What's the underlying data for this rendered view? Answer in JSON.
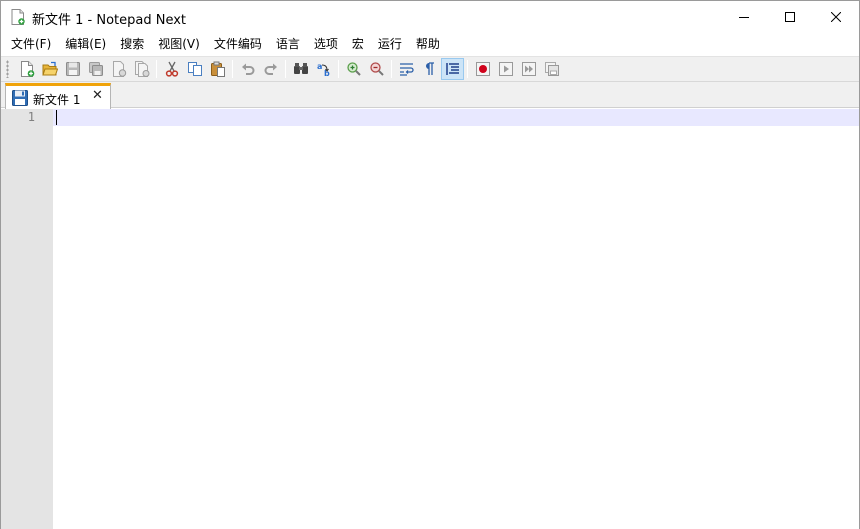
{
  "window": {
    "title": "新文件 1 - Notepad Next"
  },
  "menu": {
    "items": [
      "文件(F)",
      "编辑(E)",
      "搜索",
      "视图(V)",
      "文件编码",
      "语言",
      "选项",
      "宏",
      "运行",
      "帮助"
    ]
  },
  "toolbar": {
    "icons": [
      "new-file-icon",
      "open-file-icon",
      "save-icon",
      "save-all-icon",
      "close-icon",
      "close-all-icon",
      "cut-icon",
      "copy-icon",
      "paste-icon",
      "undo-icon",
      "redo-icon",
      "find-icon",
      "replace-icon",
      "zoom-in-icon",
      "zoom-out-icon",
      "word-wrap-icon",
      "show-all-chars-icon",
      "indent-guide-icon",
      "record-macro-icon",
      "play-macro-icon",
      "run-macro-multiple-icon",
      "save-macro-icon"
    ],
    "active": "indent-guide-icon"
  },
  "tabs": [
    {
      "label": "新文件 1",
      "close": "✕"
    }
  ],
  "editor": {
    "line_numbers": [
      "1"
    ],
    "content": ""
  },
  "colors": {
    "tab_accent": "#f0a30a",
    "current_line": "#e8e8ff",
    "gutter": "#e4e4e4"
  }
}
